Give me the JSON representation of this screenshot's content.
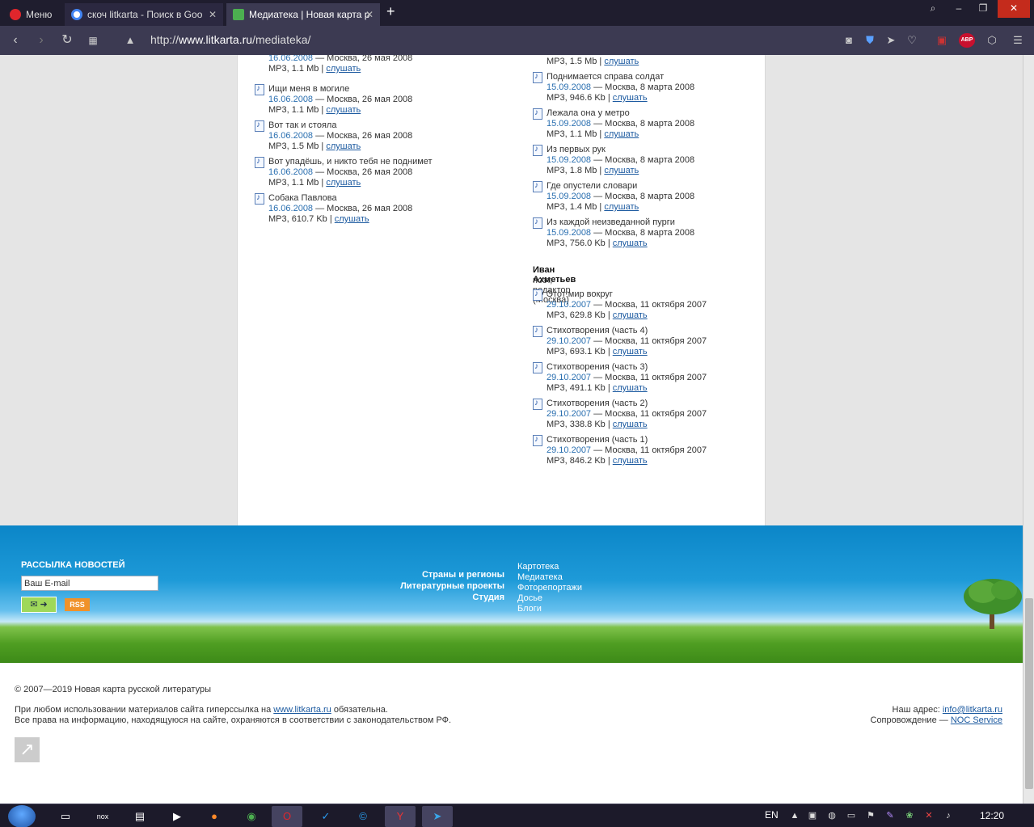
{
  "browser": {
    "menu_label": "Меню",
    "tabs": [
      {
        "title": "скоч litkarta - Поиск в Goo"
      },
      {
        "title": "Медиатека | Новая карта р"
      }
    ],
    "url_prefix": "http://",
    "url_host": "www.litkarta.ru",
    "url_path": "/mediateka/",
    "abp_label": "ABP",
    "colors": {
      "tabbar": "#1f1d2e",
      "addressbar": "#3c3a52"
    }
  },
  "left_column": {
    "tracks": [
      {
        "title": "",
        "date": "16.06.2008",
        "place": " — Москва, 26 мая 2008",
        "meta": "MP3, 1.1 Mb",
        "listen": "слушать"
      },
      {
        "title": "Ищи меня в могиле",
        "date": "16.06.2008",
        "place": " — Москва, 26 мая 2008",
        "meta": "MP3, 1.1 Mb",
        "listen": "слушать"
      },
      {
        "title": "Вот так и стояла",
        "date": "16.06.2008",
        "place": " — Москва, 26 мая 2008",
        "meta": "MP3, 1.5 Mb",
        "listen": "слушать"
      },
      {
        "title": "Вот упадёшь, и никто тебя не поднимет",
        "date": "16.06.2008",
        "place": " — Москва, 26 мая 2008",
        "meta": "MP3, 1.1 Mb",
        "listen": "слушать"
      },
      {
        "title": "Собака Павлова",
        "date": "16.06.2008",
        "place": " — Москва, 26 мая 2008",
        "meta": "MP3, 610.7 Kb",
        "listen": "слушать"
      }
    ]
  },
  "right_column": {
    "top_meta": "MP3, 1.5 Mb",
    "top_listen": "слушать",
    "tracks": [
      {
        "title": "Поднимается справа солдат",
        "date": "15.09.2008",
        "place": " — Москва, 8 марта 2008",
        "meta": "MP3, 946.6 Kb",
        "listen": "слушать"
      },
      {
        "title": "Лежала она у метро",
        "date": "15.09.2008",
        "place": " — Москва, 8 марта 2008",
        "meta": "MP3, 1.1 Mb",
        "listen": "слушать"
      },
      {
        "title": "Из первых рук",
        "date": "15.09.2008",
        "place": " — Москва, 8 марта 2008",
        "meta": "MP3, 1.8 Mb",
        "listen": "слушать"
      },
      {
        "title": "Где опустели словари",
        "date": "15.09.2008",
        "place": " — Москва, 8 марта 2008",
        "meta": "MP3, 1.4 Mb",
        "listen": "слушать"
      },
      {
        "title": "Из каждой неизведанной пурги",
        "date": "15.09.2008",
        "place": " — Москва, 8 марта 2008",
        "meta": "MP3, 756.0 Kb",
        "listen": "слушать"
      }
    ],
    "author": {
      "name": "Иван Ахметьев",
      "role": "поэт, редактор (Москва)"
    },
    "author_tracks": [
      {
        "title": "Этот мир вокруг",
        "date": "29.10.2007",
        "place": " — Москва, 11 октября 2007",
        "meta": "MP3, 629.8 Kb",
        "listen": "слушать"
      },
      {
        "title": "Стихотворения (часть 4)",
        "date": "29.10.2007",
        "place": " — Москва, 11 октября 2007",
        "meta": "MP3, 693.1 Kb",
        "listen": "слушать"
      },
      {
        "title": "Стихотворения (часть 3)",
        "date": "29.10.2007",
        "place": " — Москва, 11 октября 2007",
        "meta": "MP3, 491.1 Kb",
        "listen": "слушать"
      },
      {
        "title": "Стихотворения (часть 2)",
        "date": "29.10.2007",
        "place": " — Москва, 11 октября 2007",
        "meta": "MP3, 338.8 Kb",
        "listen": "слушать"
      },
      {
        "title": "Стихотворения (часть 1)",
        "date": "29.10.2007",
        "place": " — Москва, 11 октября 2007",
        "meta": "MP3, 846.2 Kb",
        "listen": "слушать"
      }
    ]
  },
  "footer": {
    "newsletter_title": "РАССЫЛКА НОВОСТЕЙ",
    "email_value": "Ваш E-mail",
    "subscribe_icon": "✉ ➜",
    "rss_label": "RSS",
    "left_links": [
      "Страны и регионы",
      "Литературные проекты",
      "Студия"
    ],
    "right_links": [
      "Картотека",
      "Медиатека",
      "Фоторепортажи",
      "Досье",
      "Блоги"
    ],
    "copyright": "© 2007—2019 Новая карта русской литературы",
    "notice_prefix": "При любом использовании материалов сайта гиперссылка на ",
    "notice_link": "www.litkarta.ru",
    "notice_suffix": " обязательна.",
    "notice_rights": "Все права на информацию, находящуюся на сайте, охраняются в соответствии с законодательством РФ.",
    "address_label": "Наш адрес: ",
    "address_email": "info@litkarta.ru",
    "support_label": "Сопровождение — ",
    "support_link": "NOC Service"
  },
  "taskbar": {
    "lang": "EN",
    "time": "12:20"
  }
}
